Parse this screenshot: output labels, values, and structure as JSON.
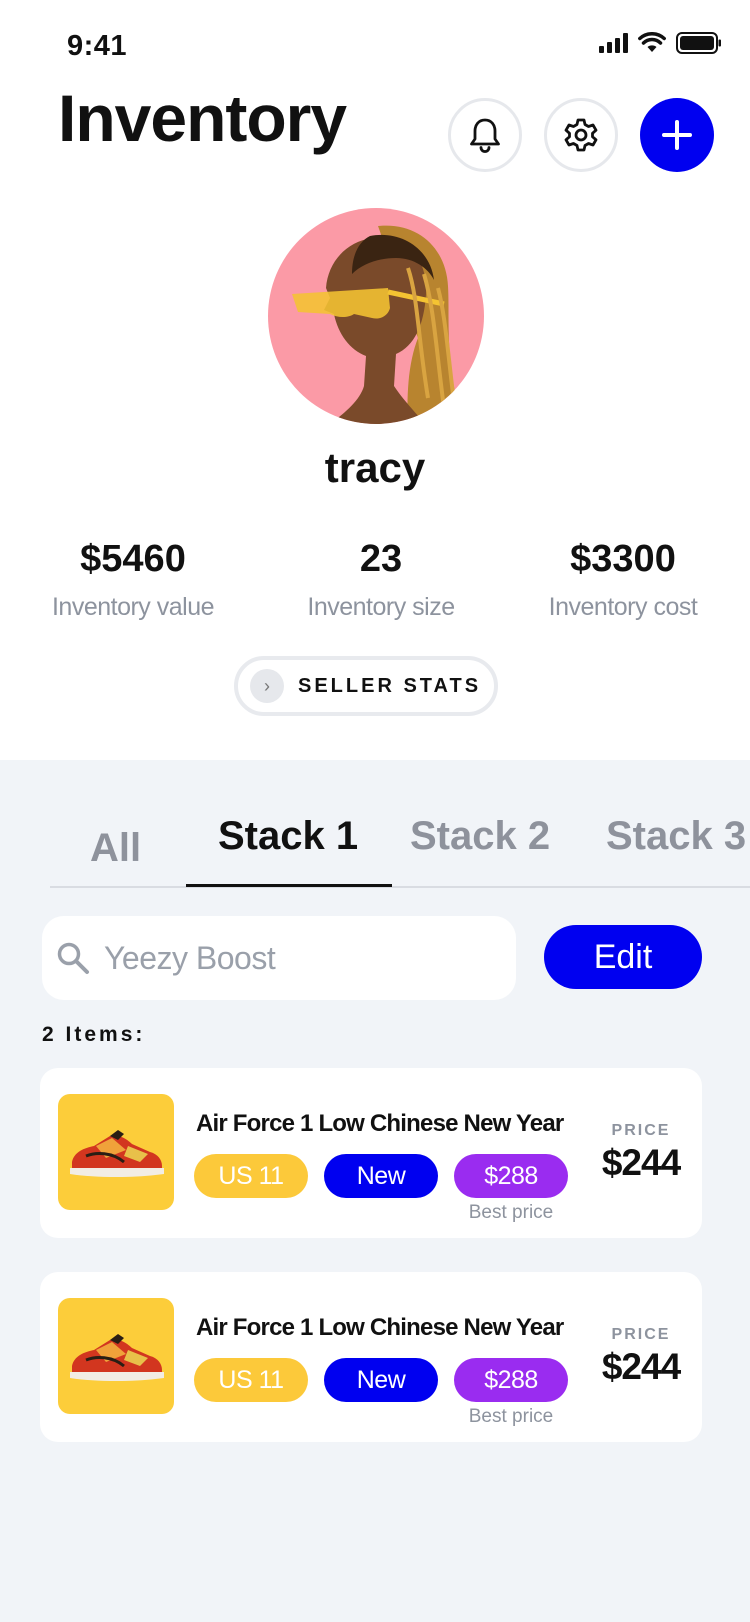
{
  "status": {
    "time": "9:41"
  },
  "header": {
    "title": "Inventory"
  },
  "profile": {
    "username": "tracy"
  },
  "stats": [
    {
      "value": "$5460",
      "label": "Inventory value"
    },
    {
      "value": "23",
      "label": "Inventory size"
    },
    {
      "value": "$3300",
      "label": "Inventory cost"
    }
  ],
  "seller_stats": {
    "label": "SELLER STATS"
  },
  "tabs": [
    {
      "label": "All",
      "active": false
    },
    {
      "label": "Stack 1",
      "active": true
    },
    {
      "label": "Stack 2",
      "active": false
    },
    {
      "label": "Stack 3",
      "active": false
    }
  ],
  "search": {
    "placeholder": "Yeezy Boost"
  },
  "edit": {
    "label": "Edit"
  },
  "items_count": "2 Items:",
  "items": [
    {
      "name": "Air Force 1 Low Chinese New Year",
      "size": "US 11",
      "condition": "New",
      "best_price": "$288",
      "best_label": "Best price",
      "price_label": "PRICE",
      "price": "$244"
    },
    {
      "name": "Air Force 1 Low Chinese New Year",
      "size": "US 11",
      "condition": "New",
      "best_price": "$288",
      "best_label": "Best price",
      "price_label": "PRICE",
      "price": "$244"
    }
  ],
  "colors": {
    "accent": "#0000f0",
    "size_pill": "#fcc93a",
    "best_pill": "#9a2cf0",
    "avatar_bg": "#fb9aa6",
    "page_bg": "#f1f4f8"
  }
}
